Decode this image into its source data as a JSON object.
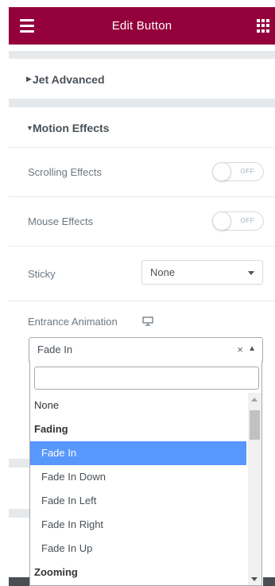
{
  "header": {
    "title": "Edit Button",
    "menu_icon": "hamburger-icon",
    "apps_icon": "grid-icon",
    "bg_color": "#93003c"
  },
  "sections": {
    "jet_advanced": {
      "label": "Jet Advanced",
      "expanded": false
    },
    "motion_effects": {
      "label": "Motion Effects",
      "expanded": true
    }
  },
  "controls": {
    "scrolling_effects": {
      "label": "Scrolling Effects",
      "state": "OFF"
    },
    "mouse_effects": {
      "label": "Mouse Effects",
      "state": "OFF"
    },
    "sticky": {
      "label": "Sticky",
      "value": "None"
    },
    "entrance_animation": {
      "label": "Entrance Animation",
      "device_icon": "desktop-monitor-icon",
      "value": "Fade In",
      "clear_glyph": "×",
      "open_glyph": "▲"
    }
  },
  "dropdown": {
    "search_value": "",
    "options": [
      {
        "label": "None",
        "type": "option"
      },
      {
        "label": "Fading",
        "type": "group"
      },
      {
        "label": "Fade In",
        "type": "child",
        "selected": true
      },
      {
        "label": "Fade In Down",
        "type": "child"
      },
      {
        "label": "Fade In Left",
        "type": "child"
      },
      {
        "label": "Fade In Right",
        "type": "child"
      },
      {
        "label": "Fade In Up",
        "type": "child"
      },
      {
        "label": "Zooming",
        "type": "group"
      }
    ],
    "highlight_color": "#5897fb"
  }
}
